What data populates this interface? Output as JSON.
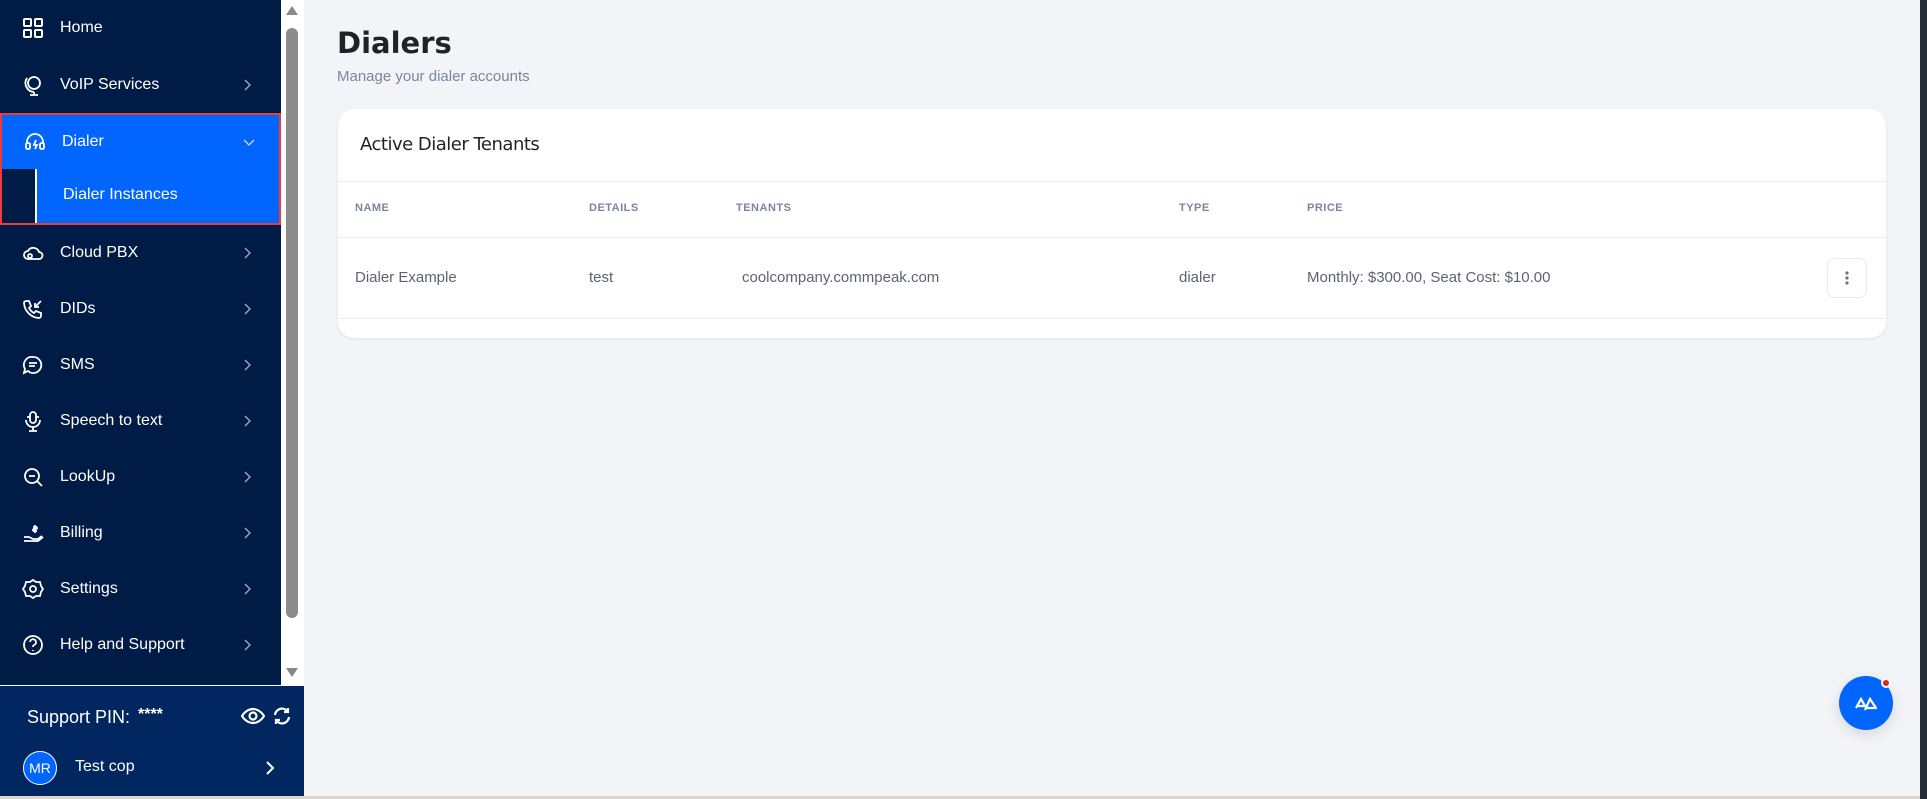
{
  "sidebar": {
    "items": [
      {
        "label": "Home",
        "icon": "grid-icon"
      },
      {
        "label": "VoIP Services",
        "icon": "globe-icon"
      },
      {
        "label": "Dialer",
        "icon": "headset-icon"
      },
      {
        "label": "Cloud PBX",
        "icon": "cloud-phone-icon"
      },
      {
        "label": "DIDs",
        "icon": "incoming-call-icon"
      },
      {
        "label": "SMS",
        "icon": "chat-icon"
      },
      {
        "label": "Speech to text",
        "icon": "microphone-icon"
      },
      {
        "label": "LookUp",
        "icon": "search-icon"
      },
      {
        "label": "Billing",
        "icon": "hand-dollar-icon"
      },
      {
        "label": "Settings",
        "icon": "gear-icon"
      },
      {
        "label": "Help and Support",
        "icon": "help-icon"
      }
    ],
    "dialer_sub": {
      "label": "Dialer Instances"
    }
  },
  "footer": {
    "pin_label": "Support PIN:",
    "pin_value": "****",
    "avatar": "MR",
    "user": "Test cop"
  },
  "page": {
    "title": "Dialers",
    "subtitle": "Manage your dialer accounts"
  },
  "card": {
    "title": "Active Dialer Tenants",
    "columns": [
      "NAME",
      "DETAILS",
      "TENANTS",
      "TYPE",
      "PRICE"
    ],
    "rows": [
      {
        "name": "Dialer Example",
        "details": "test",
        "tenants": "coolcompany.commpeak.com",
        "type": "dialer",
        "price": "Monthly: $300.00, Seat Cost: $10.00"
      }
    ]
  },
  "colors": {
    "sidebar": "#001b45",
    "accent": "#0066ff",
    "footer": "#012660"
  }
}
